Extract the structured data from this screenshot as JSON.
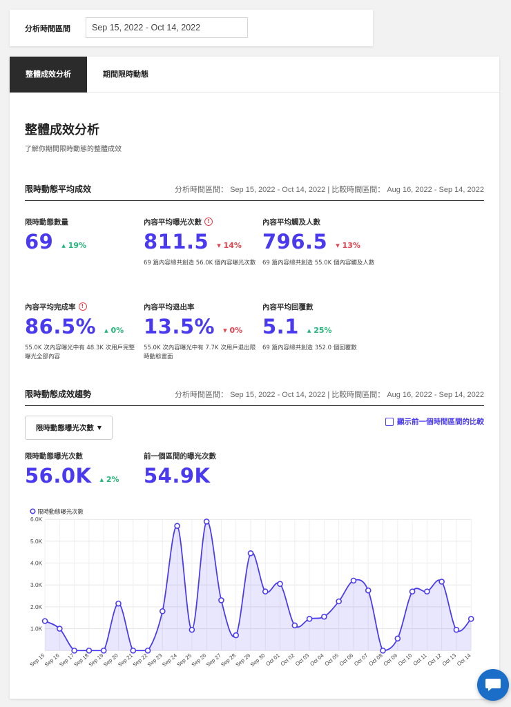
{
  "date_filter": {
    "label": "分析時間區間",
    "value": "Sep 15, 2022 - Oct 14, 2022"
  },
  "tabs": [
    {
      "label": "整體成效分析",
      "active": true
    },
    {
      "label": "期間限時動態",
      "active": false
    }
  ],
  "page": {
    "title": "整體成效分析",
    "subtitle": "了解你期間限時動態的整體成效"
  },
  "summary": {
    "title": "限時動態平均成效",
    "meta": "分析時間區間： Sep 15, 2022 - Oct 14, 2022 | 比較時間區間： Aug 16, 2022 - Sep 14, 2022",
    "metrics": [
      {
        "label": "限時動態數量",
        "value": "69",
        "change": "19%",
        "direction": "up",
        "desc": "",
        "info": false
      },
      {
        "label": "內容平均曝光次數",
        "value": "811.5",
        "change": "14%",
        "direction": "down",
        "desc": "69 篇內容總共創造 56.0K 個內容曝光次數",
        "info": true
      },
      {
        "label": "內容平均觸及人數",
        "value": "796.5",
        "change": "13%",
        "direction": "down",
        "desc": "69 篇內容總共創造 55.0K 個內容觸及人數",
        "info": false
      },
      {
        "label": "內容平均完成率",
        "value": "86.5%",
        "change": "0%",
        "direction": "up",
        "desc": "55.0K 次內容曝光中有 48.3K 次用戶完整曝光全部內容",
        "info": true
      },
      {
        "label": "內容平均退出率",
        "value": "13.5%",
        "change": "0%",
        "direction": "down",
        "desc": "55.0K 次內容曝光中有 7.7K 次用戶退出限時動態畫面",
        "info": false
      },
      {
        "label": "內容平均回覆數",
        "value": "5.1",
        "change": "25%",
        "direction": "up",
        "desc": "69 篇內容總共創造 352.0 個回覆數",
        "info": false
      }
    ]
  },
  "trend": {
    "title": "限時動態成效趨勢",
    "meta": "分析時間區間： Sep 15, 2022 - Oct 14, 2022 | 比較時間區間： Aug 16, 2022 - Sep 14, 2022",
    "dropdown": "限時動態曝光次數",
    "compare_label": "顯示前一個時間區間的比較",
    "stats": [
      {
        "label": "限時動態曝光次數",
        "value": "56.0K",
        "change": "2%",
        "direction": "up"
      },
      {
        "label": "前一個區間的曝光次數",
        "value": "54.9K"
      }
    ]
  },
  "colors": {
    "accent": "#4a3aef",
    "up": "#25b47a",
    "down": "#e0434b",
    "chat": "#1a6ec8"
  },
  "icons": {
    "info": "info-circle-icon",
    "chat": "chat-bubble-icon",
    "caret": "caret-down-icon"
  },
  "chart_data": {
    "type": "area",
    "legend": "限時動態曝光次數",
    "legend_position": "top-left",
    "grid": true,
    "ylim": [
      0,
      6000
    ],
    "yticks": [
      {
        "v": 1000,
        "label": "1.0K"
      },
      {
        "v": 2000,
        "label": "2.0K"
      },
      {
        "v": 3000,
        "label": "3.0K"
      },
      {
        "v": 4000,
        "label": "4.0K"
      },
      {
        "v": 5000,
        "label": "5.0K"
      },
      {
        "v": 6000,
        "label": "6.0K"
      }
    ],
    "categories": [
      "Sep 15",
      "Sep 16",
      "Sep 17",
      "Sep 18",
      "Sep 19",
      "Sep 20",
      "Sep 21",
      "Sep 22",
      "Sep 23",
      "Sep 24",
      "Sep 25",
      "Sep 26",
      "Sep 27",
      "Sep 28",
      "Sep 29",
      "Sep 30",
      "Oct 01",
      "Oct 02",
      "Oct 03",
      "Oct 04",
      "Oct 05",
      "Oct 06",
      "Oct 07",
      "Oct 08",
      "Oct 09",
      "Oct 10",
      "Oct 11",
      "Oct 12",
      "Oct 13",
      "Oct 14"
    ],
    "values": [
      1350,
      1000,
      0,
      0,
      0,
      2150,
      0,
      0,
      1800,
      5700,
      950,
      5900,
      2300,
      700,
      4450,
      2700,
      3050,
      1150,
      1450,
      1550,
      2250,
      3200,
      2750,
      0,
      550,
      2700,
      2700,
      3150,
      950,
      1450
    ]
  }
}
